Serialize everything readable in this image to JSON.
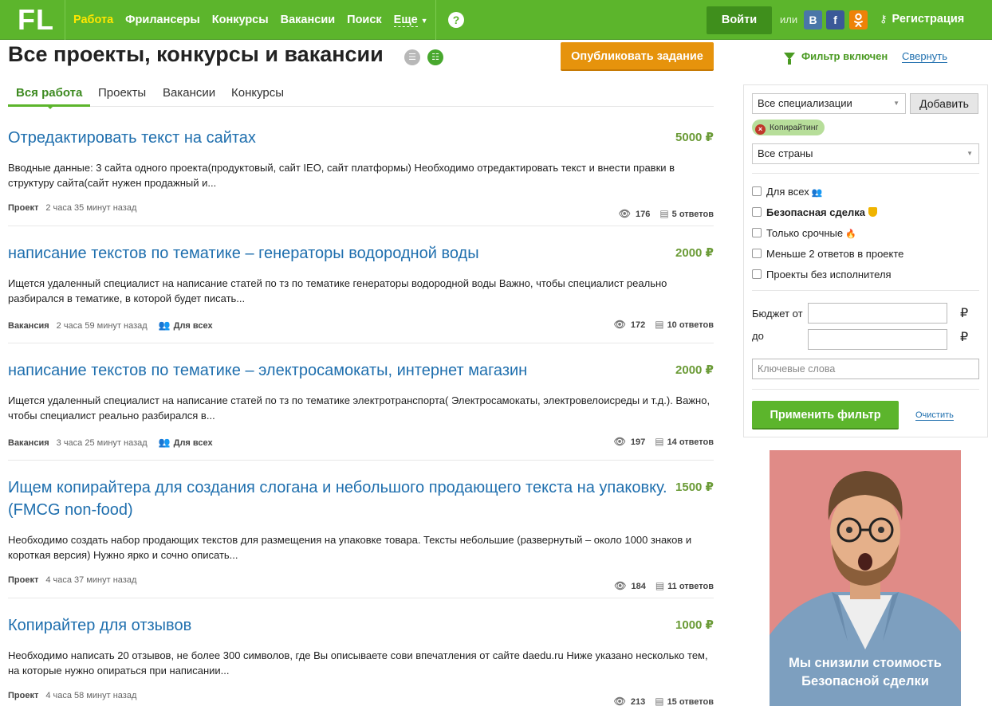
{
  "header": {
    "logo": "FL",
    "nav": [
      "Работа",
      "Фрилансеры",
      "Конкурсы",
      "Вакансии",
      "Поиск"
    ],
    "more": "Еще",
    "help": "?",
    "login": "Войти",
    "or": "или",
    "social": [
      "B",
      "f",
      "ok"
    ],
    "register": "Регистрация"
  },
  "page": {
    "title": "Все проекты, конкурсы и вакансии",
    "publish": "Опубликовать задание",
    "tabs": [
      "Вся работа",
      "Проекты",
      "Вакансии",
      "Конкурсы"
    ]
  },
  "projects": [
    {
      "title": "Отредактировать текст на сайтах",
      "price": "5000 ₽",
      "desc": "Вводные данные: 3 сайта одного проекта(продуктовый, сайт IEO, сайт платформы) Необходимо отредактировать текст и внести правки в структуру сайта(сайт нужен продажный и...",
      "type": "Проект",
      "time": "2 часа 35 минут назад",
      "for_all": "",
      "views": "176",
      "answers": "5 ответов"
    },
    {
      "title": "написание текстов по тематике – генераторы водородной воды",
      "price": "2000 ₽",
      "desc": "Ищется удаленный специалист на написание статей по тз по тематике генераторы водородной воды Важно, чтобы специалист реально разбирался в тематике, в которой будет писать...",
      "type": "Вакансия",
      "time": "2 часа 59 минут назад",
      "for_all": "Для всех",
      "views": "172",
      "answers": "10 ответов"
    },
    {
      "title": "написание текстов по тематике – электросамокаты, интернет магазин",
      "price": "2000 ₽",
      "desc": "Ищется удаленный специалист на написание статей по тз по тематике электротранспорта( Электросамокаты, электровелоисреды и т.д.). Важно, чтобы специалист реально разбирался в...",
      "type": "Вакансия",
      "time": "3 часа 25 минут назад",
      "for_all": "Для всех",
      "views": "197",
      "answers": "14 ответов"
    },
    {
      "title": "Ищем копирайтера для создания слогана и небольшого продающего текста на упаковку. (FMCG non-food)",
      "price": "1500 ₽",
      "desc": "Необходимо создать набор продающих текстов для размещения на упаковке товара. Тексты небольшие (развернутый – около 1000 знаков и короткая версия) Нужно ярко и сочно описать...",
      "type": "Проект",
      "time": "4 часа 37 минут назад",
      "for_all": "",
      "views": "184",
      "answers": "11 ответов"
    },
    {
      "title": "Копирайтер для отзывов",
      "price": "1000 ₽",
      "desc": "Необходимо написать 20 отзывов, не более 300 символов, где Вы описываете сови впечатления от сайте daedu.ru Ниже указано несколько тем, на которые нужно опираться при написании...",
      "type": "Проект",
      "time": "4 часа 58 минут назад",
      "for_all": "",
      "views": "213",
      "answers": "15 ответов"
    }
  ],
  "filter": {
    "status": "Фильтр включен",
    "collapse": "Свернуть",
    "specialization": "Все специализации",
    "add": "Добавить",
    "tag": "Копирайтинг",
    "countries": "Все страны",
    "checks": [
      "Для всех",
      "Безопасная сделка",
      "Только срочные",
      "Меньше 2 ответов в проекте",
      "Проекты без исполнителя"
    ],
    "budget_from": "Бюджет от",
    "budget_to": "до",
    "currency": "₽",
    "keywords_placeholder": "Ключевые слова",
    "apply": "Применить фильтр",
    "clear": "Очистить"
  },
  "ad": {
    "line1": "Мы снизили стоимость",
    "line2": "Безопасной сделки"
  }
}
